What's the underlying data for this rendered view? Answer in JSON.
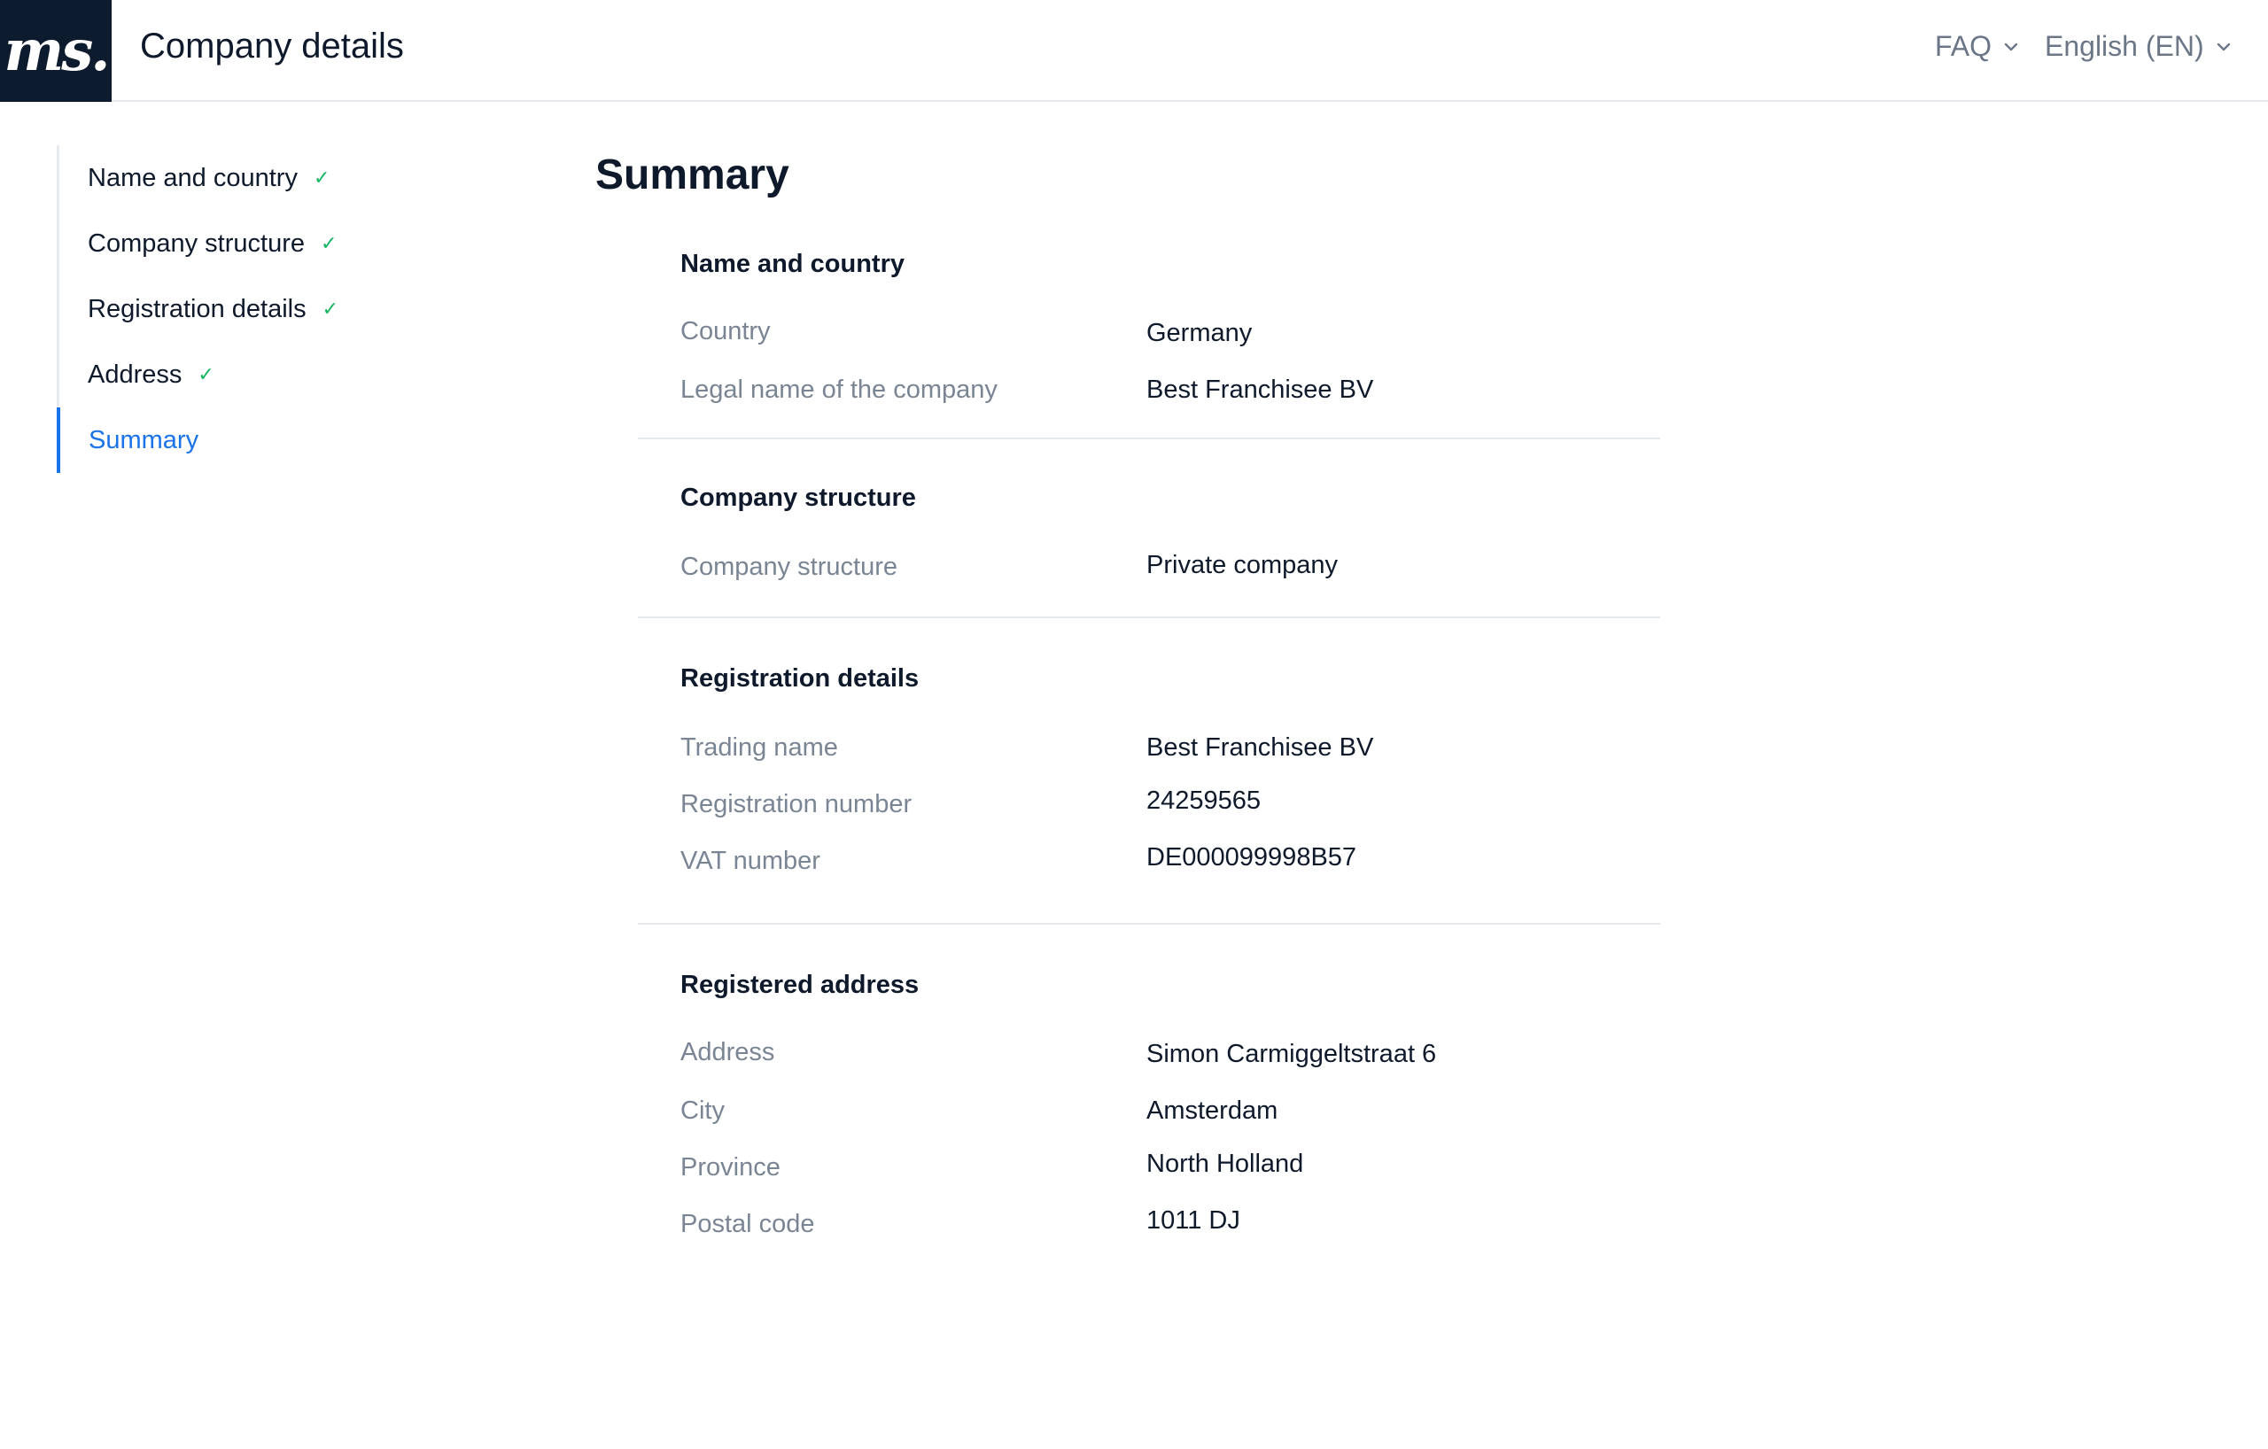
{
  "header": {
    "logo_text": "ms.",
    "title": "Company details",
    "faq_label": "FAQ",
    "language_label": "English (EN)"
  },
  "sidebar": {
    "items": [
      {
        "label": "Name and country",
        "complete": "✓"
      },
      {
        "label": "Company structure",
        "complete": "✓"
      },
      {
        "label": "Registration details",
        "complete": "✓"
      },
      {
        "label": "Address",
        "complete": "✓"
      },
      {
        "label": "Summary",
        "active": true
      }
    ]
  },
  "main": {
    "title": "Summary",
    "sections": [
      {
        "title": "Name and country",
        "fields": [
          {
            "label": "Country",
            "value": "Germany"
          },
          {
            "label": "Legal name of the company",
            "value": "Best Franchisee BV"
          }
        ]
      },
      {
        "title": "Company structure",
        "fields": [
          {
            "label": "Company structure",
            "value": "Private company"
          }
        ]
      },
      {
        "title": "Registration details",
        "fields": [
          {
            "label": "Trading name",
            "value": "Best Franchisee BV"
          },
          {
            "label": "Registration number",
            "value": "24259565"
          },
          {
            "label": "VAT number",
            "value": "DE000099998B57"
          }
        ]
      },
      {
        "title": "Registered address",
        "fields": [
          {
            "label": "Address",
            "value": "Simon Carmiggeltstraat 6"
          },
          {
            "label": "City",
            "value": "Amsterdam"
          },
          {
            "label": "Province",
            "value": "North Holland"
          },
          {
            "label": "Postal code",
            "value": "1011 DJ"
          }
        ]
      }
    ]
  },
  "colors": {
    "brand_dark": "#0d1b2e",
    "accent": "#1a73e8",
    "check": "#16b564",
    "label_gray": "#7a8594"
  },
  "icons": [
    "chevron-down-icon",
    "check-icon"
  ]
}
